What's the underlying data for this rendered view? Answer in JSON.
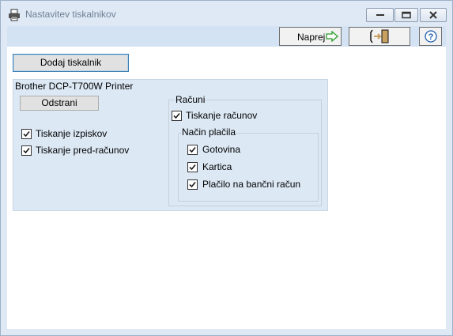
{
  "window": {
    "title": "Nastavitev tiskalnikov"
  },
  "toolbar": {
    "next_label": "Naprej"
  },
  "main": {
    "add_printer_label": "Dodaj tiskalnik",
    "printer": {
      "name": "Brother DCP-T700W Printer",
      "remove_label": "Odstrani",
      "options": [
        {
          "label": "Tiskanje izpiskov",
          "checked": true
        },
        {
          "label": "Tiskanje pred-računov",
          "checked": true
        }
      ],
      "invoices": {
        "group_label": "Računi",
        "print_label": "Tiskanje računov",
        "print_checked": true,
        "payment": {
          "group_label": "Način plačila",
          "methods": [
            {
              "label": "Gotovina",
              "checked": true
            },
            {
              "label": "Kartica",
              "checked": true
            },
            {
              "label": "Plačilo na bančni račun",
              "checked": true
            }
          ]
        }
      }
    }
  },
  "colors": {
    "accent": "#3c7fb1",
    "panel": "#dce8f4",
    "frame": "#dfe9f5",
    "toolbar": "#d4e3f3"
  }
}
